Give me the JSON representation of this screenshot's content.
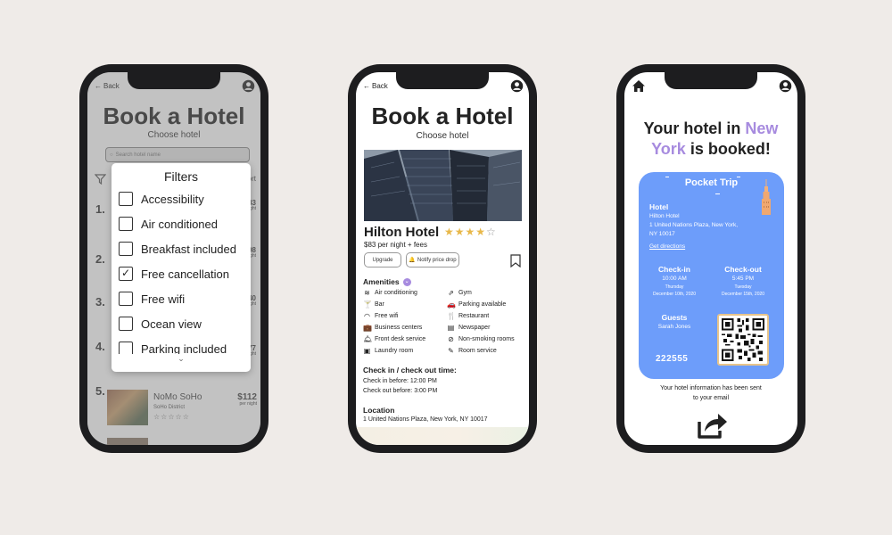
{
  "colors": {
    "background": "#efebe8",
    "accent_purple": "#a78bdf",
    "card_blue": "#6d9dfa",
    "star_gold": "#e8b84a"
  },
  "screen1": {
    "back": "Back",
    "title": "Book a Hotel",
    "subtitle": "Choose hotel",
    "search_placeholder": "Search hotel name",
    "sort_peek": "ort",
    "row_numbers": [
      "1.",
      "2.",
      "3.",
      "4.",
      "5."
    ],
    "price_peeks": [
      {
        "price": "83",
        "unit": "night"
      },
      {
        "price": "98",
        "unit": "night"
      },
      {
        "price": "40",
        "unit": "night"
      },
      {
        "price": "77",
        "unit": "night"
      }
    ],
    "filters": {
      "title": "Filters",
      "items": [
        {
          "label": "Accessibility",
          "checked": false
        },
        {
          "label": "Air conditioned",
          "checked": false
        },
        {
          "label": "Breakfast included",
          "checked": false
        },
        {
          "label": "Free cancellation",
          "checked": true
        },
        {
          "label": "Free wifi",
          "checked": false
        },
        {
          "label": "Ocean view",
          "checked": false
        },
        {
          "label": "Parking included",
          "checked": false
        }
      ],
      "check_mark": "✓",
      "chevron": "⌄"
    },
    "hotel5": {
      "name": "NoMo SoHo",
      "district": "SoHo District",
      "price": "$112",
      "unit": "per night",
      "rating_stars": "☆☆☆☆☆"
    }
  },
  "screen2": {
    "back": "Back",
    "title": "Book a Hotel",
    "subtitle": "Choose hotel",
    "hotel_name": "Hilton Hotel",
    "rating": 4,
    "stars_filled": "★★★★",
    "stars_empty": "☆",
    "price": "$83 per night + fees",
    "upgrade_button": "Upgrade",
    "notify_button": "Notify price drop",
    "amenities_title": "Amenities",
    "amenities": [
      {
        "icon": "air-conditioning-icon",
        "glyph": "≋",
        "label": "Air conditioning"
      },
      {
        "icon": "bar-icon",
        "glyph": "🍸",
        "label": "Bar"
      },
      {
        "icon": "wifi-icon",
        "glyph": "◠",
        "label": "Free wifi"
      },
      {
        "icon": "business-center-icon",
        "glyph": "💼",
        "label": "Business centers"
      },
      {
        "icon": "front-desk-icon",
        "glyph": "🛎",
        "label": "Front desk service"
      },
      {
        "icon": "laundry-icon",
        "glyph": "▣",
        "label": "Laundry room"
      },
      {
        "icon": "gym-icon",
        "glyph": "⇗",
        "label": "Gym"
      },
      {
        "icon": "parking-icon",
        "glyph": "🚗",
        "label": "Parking available"
      },
      {
        "icon": "restaurant-icon",
        "glyph": "🍴",
        "label": "Restaurant"
      },
      {
        "icon": "newspaper-icon",
        "glyph": "▤",
        "label": "Newspaper"
      },
      {
        "icon": "non-smoking-icon",
        "glyph": "⊘",
        "label": "Non-smoking rooms"
      },
      {
        "icon": "room-service-icon",
        "glyph": "✎",
        "label": "Room service"
      }
    ],
    "checkin_title": "Check in / check out time:",
    "checkin_before": "Check in before: 12:00 PM",
    "checkout_before": "Check out before: 3:00 PM",
    "location_title": "Location",
    "location": "1 United Nations Plaza, New York, NY 10017"
  },
  "screen3": {
    "headline_a": "Your hotel in ",
    "headline_city": "New York",
    "headline_b": " is booked!",
    "card_title": "Pocket Trip",
    "hotel_label": "Hotel",
    "hotel_name": "Hilton Hotel",
    "address_line1": "1 United Nations Plaza, New York,",
    "address_line2": "NY 10017",
    "directions": "Get directions",
    "checkin_label": "Check-in",
    "checkin_time": "10:00 AM",
    "checkin_day": "Thursday",
    "checkin_date": "December 10th, 2020",
    "checkout_label": "Check-out",
    "checkout_time": "5:45 PM",
    "checkout_day": "Tuesday",
    "checkout_date": "December 15th, 2020",
    "guests_label": "Guests",
    "guest_name": "Sarah Jones",
    "confirmation": "222555",
    "sent_line1": "Your hotel information has been sent",
    "sent_line2": "to your email"
  }
}
